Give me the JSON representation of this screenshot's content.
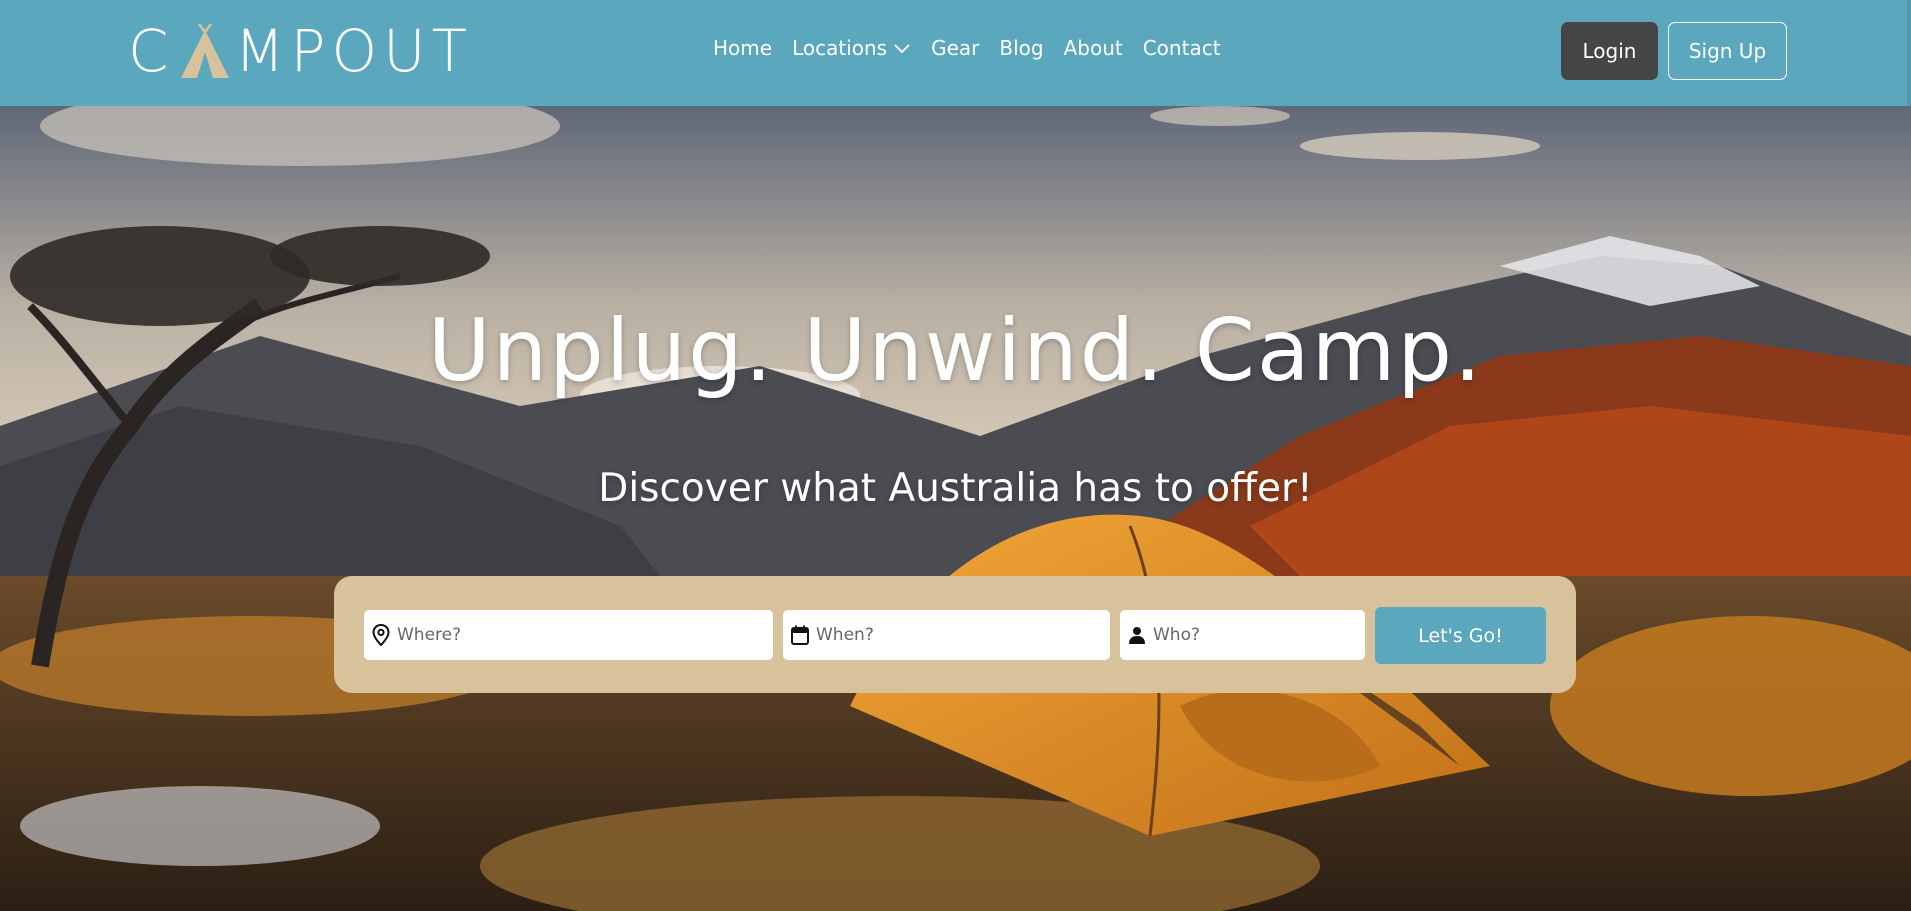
{
  "brand": {
    "logo_text_left": "C",
    "logo_text_right": "MPOUT",
    "logo_colors": {
      "text": "#ffffff",
      "tent": "#d7c29c"
    }
  },
  "nav": {
    "items": [
      {
        "label": "Home"
      },
      {
        "label": "Locations",
        "has_dropdown": true,
        "icon": "chevron-down-icon"
      },
      {
        "label": "Gear"
      },
      {
        "label": "Blog"
      },
      {
        "label": "About"
      },
      {
        "label": "Contact"
      }
    ],
    "login_label": "Login",
    "signup_label": "Sign Up"
  },
  "hero": {
    "headline": "Unplug. Unwind. Camp.",
    "subheadline": "Discover what Australia has to offer!"
  },
  "search": {
    "where": {
      "placeholder": "Where?",
      "icon": "map-pin-icon",
      "value": ""
    },
    "when": {
      "placeholder": "When?",
      "icon": "calendar-icon",
      "value": ""
    },
    "who": {
      "placeholder": "Who?",
      "icon": "person-icon",
      "value": ""
    },
    "submit_label": "Let's Go!"
  },
  "colors": {
    "accent": "#5ba7bd",
    "login_bg": "#454545",
    "search_panel": "#d7c29c"
  }
}
